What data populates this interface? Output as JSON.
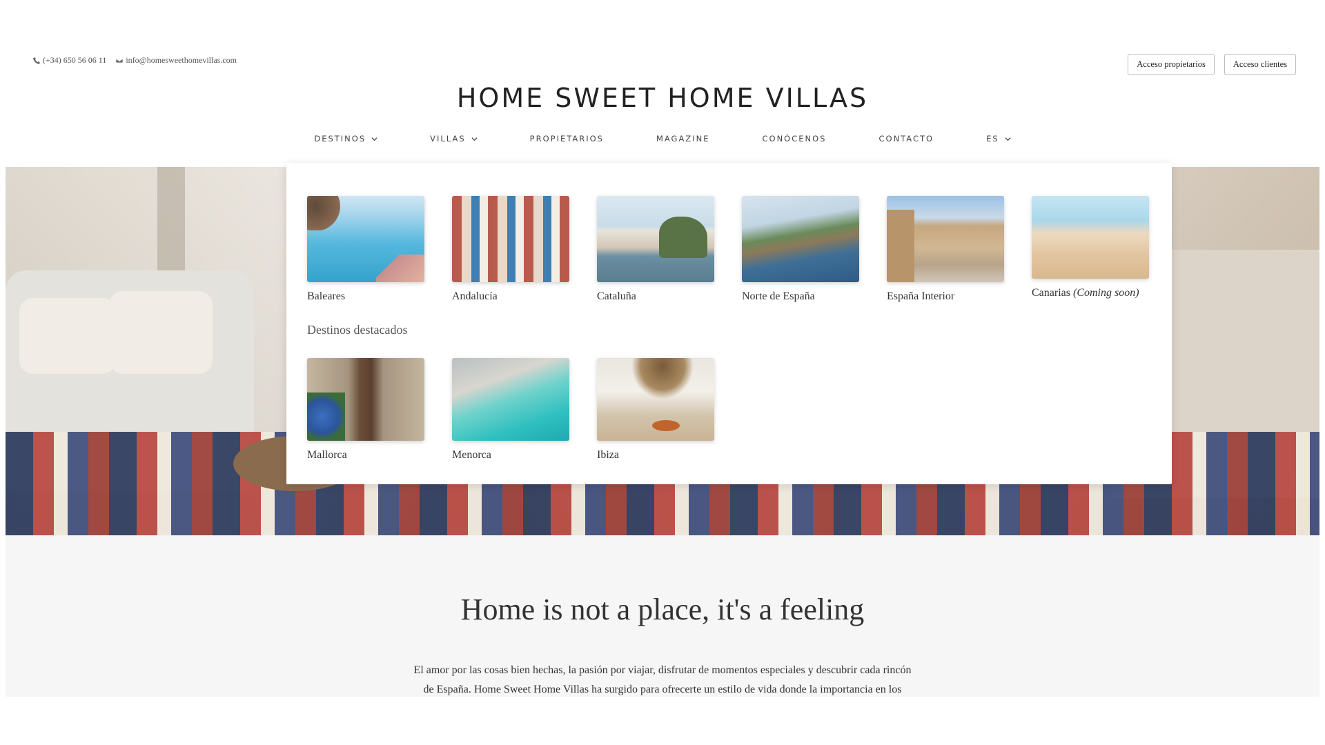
{
  "topbar": {
    "phone": "(+34) 650 56 06 11",
    "email": "info@homesweethomevillas.com",
    "owners_button": "Acceso propietarios",
    "clients_button": "Acceso clientes"
  },
  "logo": {
    "text": "HOME SWEET HOME VILLAS"
  },
  "nav": {
    "destinos": "DESTINOS",
    "villas": "VILLAS",
    "propietarios": "PROPIETARIOS",
    "magazine": "MAGAZINE",
    "conocenos": "CONÓCENOS",
    "contacto": "CONTACTO",
    "lang": "ES"
  },
  "dropdown": {
    "regions": [
      {
        "label": "Baleares"
      },
      {
        "label": "Andalucía"
      },
      {
        "label": "Cataluña"
      },
      {
        "label": "Norte de España"
      },
      {
        "label": "España Interior"
      },
      {
        "label": "Canarias",
        "note": "(Coming soon)"
      }
    ],
    "featured_title": "Destinos destacados",
    "featured": [
      {
        "label": "Mallorca"
      },
      {
        "label": "Menorca"
      },
      {
        "label": "Ibiza"
      }
    ]
  },
  "about": {
    "headline": "Home is not a place, it's a feeling",
    "line1": "El amor por las cosas bien hechas, la pasión por viajar, disfrutar de momentos especiales y descubrir cada rincón",
    "line2": "de España. Home Sweet Home Villas ha surgido para ofrecerte un estilo de vida donde la importancia en los"
  }
}
